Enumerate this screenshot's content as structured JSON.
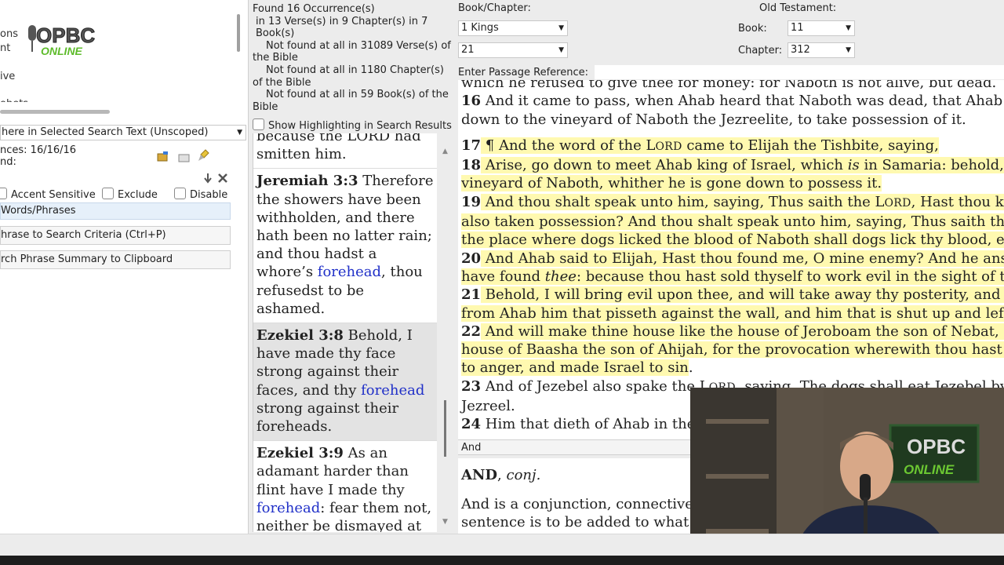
{
  "left_panel": {
    "top_list": [
      "ons",
      "nt",
      "ive",
      "ohets"
    ],
    "scope_select": "here in Selected Search Text (Unscoped)",
    "occurrences": "nces: 16/16/16",
    "found": "nd:",
    "options": {
      "accent": "Accent Sensitive",
      "exclude": "Exclude",
      "disable": "Disable"
    },
    "words_phrases": "Words/Phrases",
    "add_phrase_button": "hrase to Search Criteria (Ctrl+P)",
    "copy_summary_button": "rch Phrase Summary to Clipboard"
  },
  "stats": {
    "line1": "Found 16 Occurrence(s)",
    "line2": "in 13 Verse(s) in 9 Chapter(s) in 7 Book(s)",
    "line3": "Not found at all in 31089 Verse(s) of the Bible",
    "line4": "Not found at all in 1180 Chapter(s) of the Bible",
    "line5": "Not found at all in 59 Book(s) of the Bible",
    "show_highlighting": "Show Highlighting in Search Results"
  },
  "results": {
    "partial_top": "because the LORD had smitten him.",
    "r1": {
      "ref": "Jeremiah 3:3",
      "pre": " Therefore the showers have been withholden, and there hath been no latter rain; and thou hadst a whore’s ",
      "hl": "forehead",
      "post": ", thou refusedst to be ashamed."
    },
    "r2": {
      "ref": "Ezekiel 3:8",
      "pre": " Behold, I have made thy face strong against their faces, and thy ",
      "hl": "forehead",
      "post": " strong against their foreheads."
    },
    "r3": {
      "ref": "Ezekiel 3:9",
      "pre": " As an adamant harder than flint have I made thy ",
      "hl": "forehead",
      "post": ": fear them not, neither be dismayed at their looks, though they"
    }
  },
  "navigation": {
    "book_chapter_label": "Book/Chapter:",
    "book_value": "1 Kings",
    "chapter_value": "21",
    "testament_label": "Old Testament:",
    "book_num_label": "Book:",
    "book_num_value": "11",
    "chapter_num_label": "Chapter:",
    "chapter_num_value": "312",
    "passage_label": "Enter Passage Reference:"
  },
  "bible": {
    "l0": "which he refused to give thee for money: for Naboth is not alive, but dead.",
    "v16n": "16",
    "v16a": " And it came to pass, when Ahab heard that Naboth was dead, that Ahab rose up to go",
    "v16b": "down to the vineyard of Naboth the Jezreelite, to take possession of it.",
    "v17n": "17",
    "v17a": " ¶ And the word of the L",
    "v17sc": "ORD",
    "v17b": " came to Elijah the Tishbite, saying,",
    "v18n": "18",
    "v18a": " Arise, go down to meet Ahab king of Israel, which ",
    "v18i": "is",
    "v18b": " in Samaria: behold, he is in the",
    "v18c": "vineyard of Naboth, whither he is gone down to possess it.",
    "v19n": "19",
    "v19a": " And thou shalt speak unto him, saying, Thus saith the L",
    "v19sc": "ORD",
    "v19b": ", Hast thou killed, and",
    "v19c": "also taken possession? And thou shalt speak unto him, saying, Thus saith the LORD, In",
    "v19d": "the place where dogs licked the blood of Naboth shall dogs lick thy blood, even thine.",
    "v20n": "20",
    "v20a": " And Ahab said to Elijah, Hast thou found me, O mine enemy? And he answered, I",
    "v20b": "have found ",
    "v20i": "thee",
    "v20c": ": because thou hast sold thyself to work evil in the sight of the LORD.",
    "v21n": "21",
    "v21a": " Behold, I will bring evil upon thee, and will take away thy posterity, and will cut off",
    "v21b": "from Ahab him that pisseth against the wall, and him that is shut up and left in Israel,",
    "v22n": "22",
    "v22a": " And will make thine house like the house of Jeroboam the son of Nebat, and like the",
    "v22b": "house of Baasha the son of Ahijah, for the provocation wherewith thou hast provoked me",
    "v22c": "to anger, and made Israel to sin",
    "v22d": ".",
    "v23n": "23",
    "v23a": " And of Jezebel also spake the L",
    "v23sc": "ORD",
    "v23b": ", saying, The dogs shall eat Jezebel by the wall of",
    "v23c": "Jezreel.",
    "v24n": "24",
    "v24a": " Him that dieth of Ahab in the city the dogs shall eat; and him that dieth in the field"
  },
  "dictionary": {
    "word": "And",
    "headword": "AND",
    "pos": "conj.",
    "def1": "And is a conjunction, connective or joining word, and in sentences it is used when a",
    "def2": "sentence is to be added to what has been said."
  },
  "webcam": {
    "sign_top": "OPBC",
    "sign_bottom": "ONLINE"
  },
  "logo": {
    "top": "OPBC",
    "bottom": "ONLINE"
  },
  "colors": {
    "highlight": "#fff9b0",
    "search_hit": "#2030c8",
    "logo_green": "#2e8b2e"
  }
}
